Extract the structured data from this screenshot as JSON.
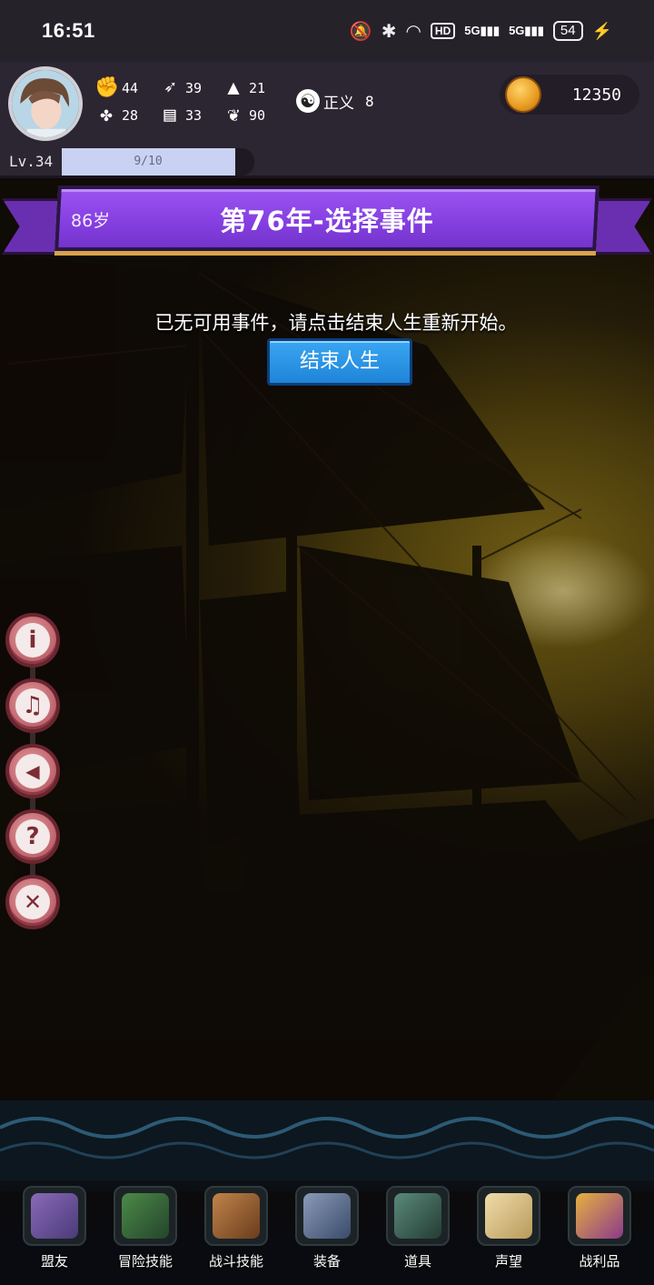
{
  "status_bar": {
    "time": "16:51",
    "hd_label": "HD",
    "signal1": "5G",
    "signal2": "5G",
    "battery": "54",
    "icons": [
      "mute-vibrate-icon",
      "bluetooth-icon",
      "wifi-icon",
      "hd-volte-icon",
      "signal-icon",
      "battery-icon",
      "charging-icon"
    ]
  },
  "hud": {
    "stats": [
      {
        "icon": "fist-icon",
        "value": "44"
      },
      {
        "icon": "clover-icon",
        "value": "28"
      },
      {
        "icon": "feather-icon",
        "value": "39"
      },
      {
        "icon": "book-icon",
        "value": "33"
      },
      {
        "icon": "wizard-hat-icon",
        "value": "21"
      },
      {
        "icon": "wings-icon",
        "value": "90"
      }
    ],
    "alignment_label": "正义",
    "alignment_value": "8",
    "coins": "12350",
    "level": "Lv.34",
    "xp_text": "9/10",
    "xp_progress": 0.9
  },
  "banner": {
    "age": "86岁",
    "title": "第76年-选择事件"
  },
  "message": "已无可用事件，请点击结束人生重新开始。",
  "end_button": "结束人生",
  "side_buttons": [
    {
      "name": "info-button",
      "icon": "info-icon",
      "glyph": "i"
    },
    {
      "name": "music-button",
      "icon": "music-note-icon",
      "glyph": "♫"
    },
    {
      "name": "sound-button",
      "icon": "speaker-icon",
      "glyph": "◀"
    },
    {
      "name": "help-button",
      "icon": "question-icon",
      "glyph": "?"
    },
    {
      "name": "close-button",
      "icon": "close-icon",
      "glyph": "✕"
    }
  ],
  "nav": [
    {
      "label": "盟友",
      "icon": "handshake-icon",
      "color": "#7a5aa8"
    },
    {
      "label": "冒险技能",
      "icon": "green-book-icon",
      "color": "#3d6a3a"
    },
    {
      "label": "战斗技能",
      "icon": "backpack-icon",
      "color": "#9a6434"
    },
    {
      "label": "装备",
      "icon": "crossed-swords-icon",
      "color": "#5a6a8a"
    },
    {
      "label": "道具",
      "icon": "satchel-icon",
      "color": "#3d5a52"
    },
    {
      "label": "声望",
      "icon": "scroll-icon",
      "color": "#d8c08a"
    },
    {
      "label": "战利品",
      "icon": "treasure-chest-icon",
      "color": "#a85a2a"
    }
  ]
}
